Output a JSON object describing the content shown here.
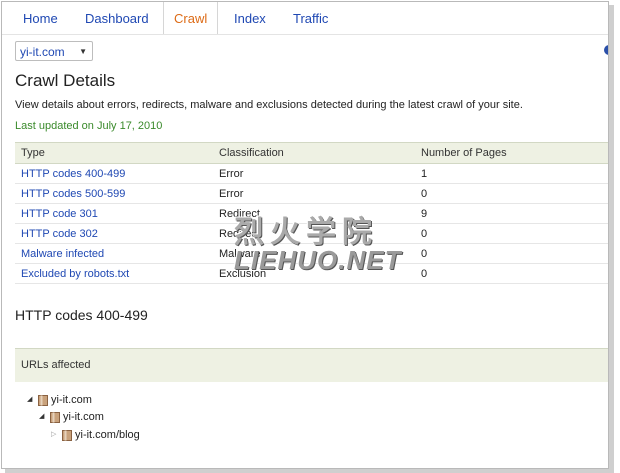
{
  "tabs": [
    {
      "label": "Home"
    },
    {
      "label": "Dashboard"
    },
    {
      "label": "Crawl"
    },
    {
      "label": "Index"
    },
    {
      "label": "Traffic"
    }
  ],
  "site_selector": {
    "value": "yi-it.com"
  },
  "page_title": "Crawl Details",
  "description": "View details about errors, redirects, malware and exclusions detected during the latest crawl of your site.",
  "last_updated": "Last updated on July 17, 2010",
  "table": {
    "headers": [
      "Type",
      "Classification",
      "Number of Pages"
    ],
    "rows": [
      {
        "type": "HTTP codes 400-499",
        "classification": "Error",
        "pages": "1"
      },
      {
        "type": "HTTP codes 500-599",
        "classification": "Error",
        "pages": "0"
      },
      {
        "type": "HTTP code 301",
        "classification": "Redirect",
        "pages": "9"
      },
      {
        "type": "HTTP code 302",
        "classification": "Redirect",
        "pages": "0"
      },
      {
        "type": "Malware infected",
        "classification": "Malware",
        "pages": "0"
      },
      {
        "type": "Excluded by robots.txt",
        "classification": "Exclusion",
        "pages": "0"
      }
    ]
  },
  "watermark": {
    "cn": "烈火学院",
    "en": "LIEHUO.NET"
  },
  "section_title": "HTTP codes 400-499",
  "urls_affected": {
    "header": "URLs affected",
    "tree": [
      {
        "label": "yi-it.com",
        "level": 0,
        "state": "expanded"
      },
      {
        "label": "yi-it.com",
        "level": 1,
        "state": "expanded"
      },
      {
        "label": "yi-it.com/blog",
        "level": 2,
        "state": "collapsed"
      }
    ]
  },
  "colors": {
    "link": "#1f48b3",
    "active_tab": "#dd6b16",
    "updated_text": "#3a8a2b",
    "table_header_bg": "#eef1e3",
    "folder": "#b98a63"
  },
  "icons": {
    "dropdown": "chevron-down-icon",
    "expanded": "triangle-down-icon",
    "collapsed": "triangle-right-icon",
    "folder": "folder-icon"
  }
}
